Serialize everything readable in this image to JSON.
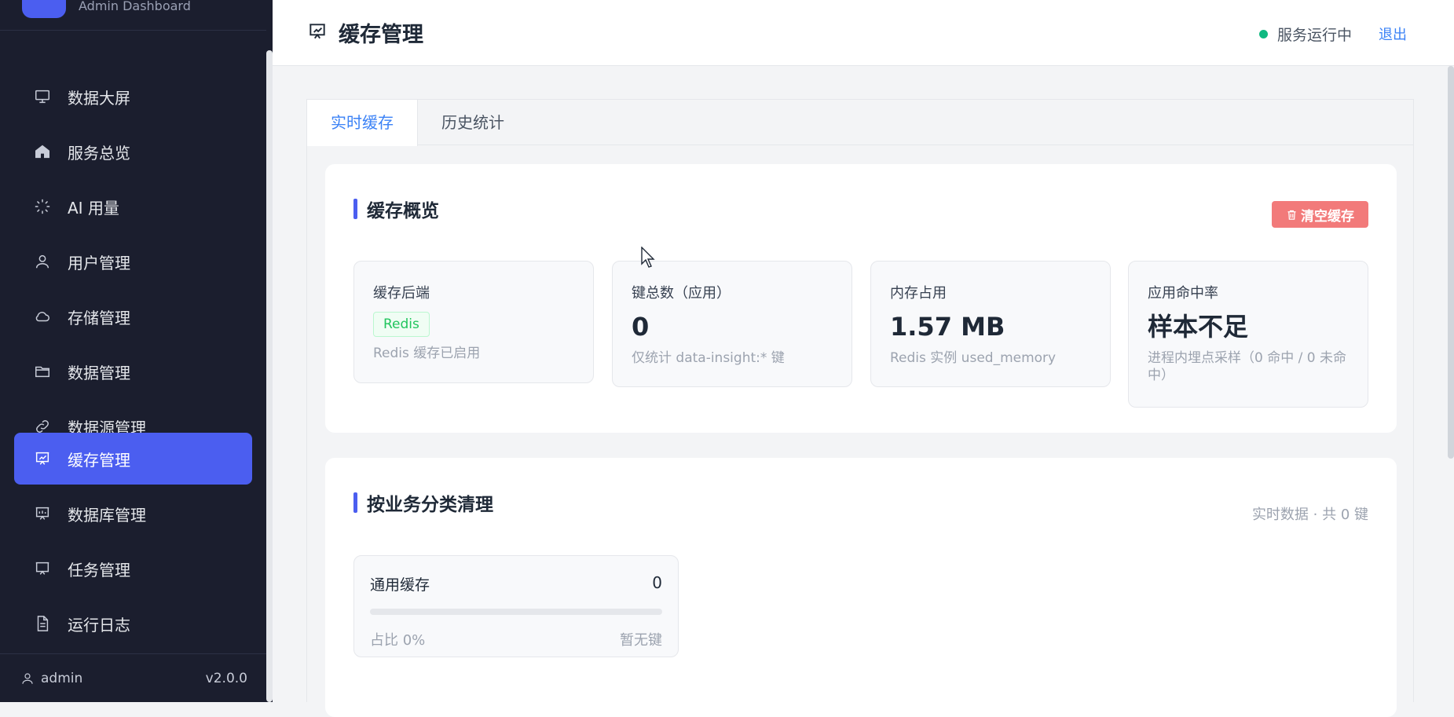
{
  "sidebar": {
    "brand_subtitle": "Admin Dashboard",
    "items": [
      {
        "label": "数据大屏",
        "icon": "monitor-icon"
      },
      {
        "label": "服务总览",
        "icon": "home-icon"
      },
      {
        "label": "AI 用量",
        "icon": "loader-icon"
      },
      {
        "label": "用户管理",
        "icon": "user-icon"
      },
      {
        "label": "存储管理",
        "icon": "cloud-icon"
      },
      {
        "label": "数据管理",
        "icon": "folder-icon"
      },
      {
        "label": "数据源管理",
        "icon": "link-icon"
      },
      {
        "label": "缓存管理",
        "icon": "presentation-chart-icon",
        "active": true
      },
      {
        "label": "数据库管理",
        "icon": "presentation-icon"
      },
      {
        "label": "任务管理",
        "icon": "board-icon"
      },
      {
        "label": "运行日志",
        "icon": "file-text-icon"
      }
    ],
    "footer": {
      "user": "admin",
      "version": "v2.0.0"
    }
  },
  "header": {
    "title": "缓存管理",
    "status_text": "服务运行中",
    "status_color": "#10b981",
    "logout_label": "退出"
  },
  "tabs": [
    {
      "label": "实时缓存",
      "active": true
    },
    {
      "label": "历史统计",
      "active": false
    }
  ],
  "overview": {
    "title": "缓存概览",
    "clear_button": "清空缓存",
    "stats": [
      {
        "label": "缓存后端",
        "tag": "Redis",
        "note": "Redis 缓存已启用"
      },
      {
        "label": "键总数（应用）",
        "value": "0",
        "note": "仅统计 data-insight:* 键"
      },
      {
        "label": "内存占用",
        "value": "1.57 MB",
        "note": "Redis 实例 used_memory"
      },
      {
        "label": "应用命中率",
        "value": "样本不足",
        "note": "进程内埋点采样（0 命中 / 0 未命中）"
      }
    ]
  },
  "categories": {
    "title": "按业务分类清理",
    "meta": "实时数据 · 共 0 键",
    "items": [
      {
        "name": "通用缓存",
        "count": "0",
        "ratio_text": "占比 0%",
        "ratio": 0,
        "keys_text": "暂无键"
      }
    ]
  },
  "colors": {
    "accent": "#4b5ef0",
    "danger": "#f27a7a",
    "link": "#3b82f6"
  }
}
